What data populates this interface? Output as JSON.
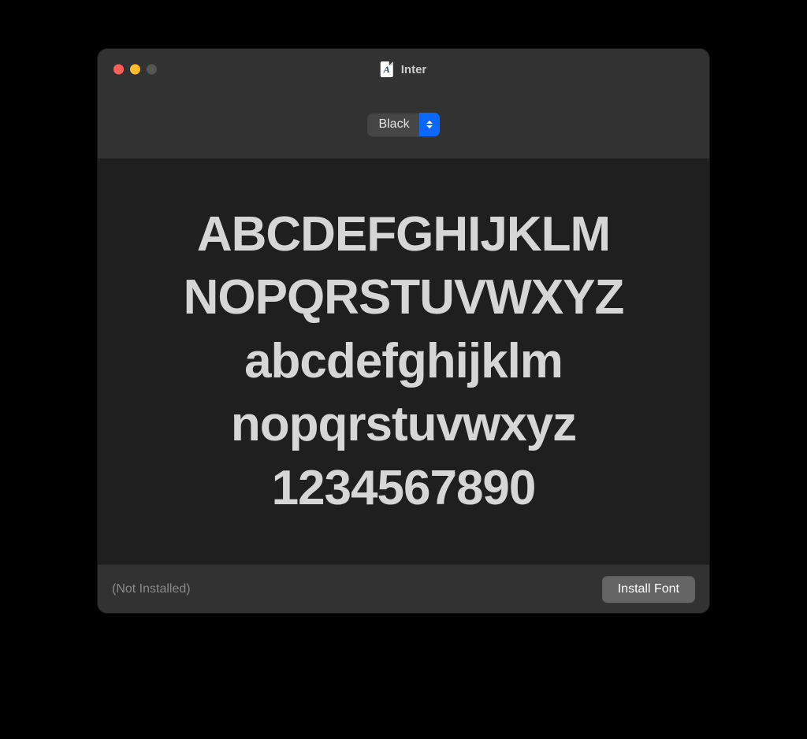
{
  "window": {
    "title": "Inter"
  },
  "toolbar": {
    "weight_selected": "Black"
  },
  "preview": {
    "lines": {
      "l0": "ABCDEFGHIJKLM",
      "l1": "NOPQRSTUVWXYZ",
      "l2": "abcdefghijklm",
      "l3": "nopqrstuvwxyz",
      "l4": "1234567890"
    }
  },
  "footer": {
    "status_label": "(Not Installed)",
    "install_label": "Install Font"
  },
  "colors": {
    "accent": "#0a68ff",
    "window_bg": "#282828",
    "preview_bg": "#1f1f1f",
    "chrome_bg": "#323232",
    "text": "#d6d6d6"
  }
}
